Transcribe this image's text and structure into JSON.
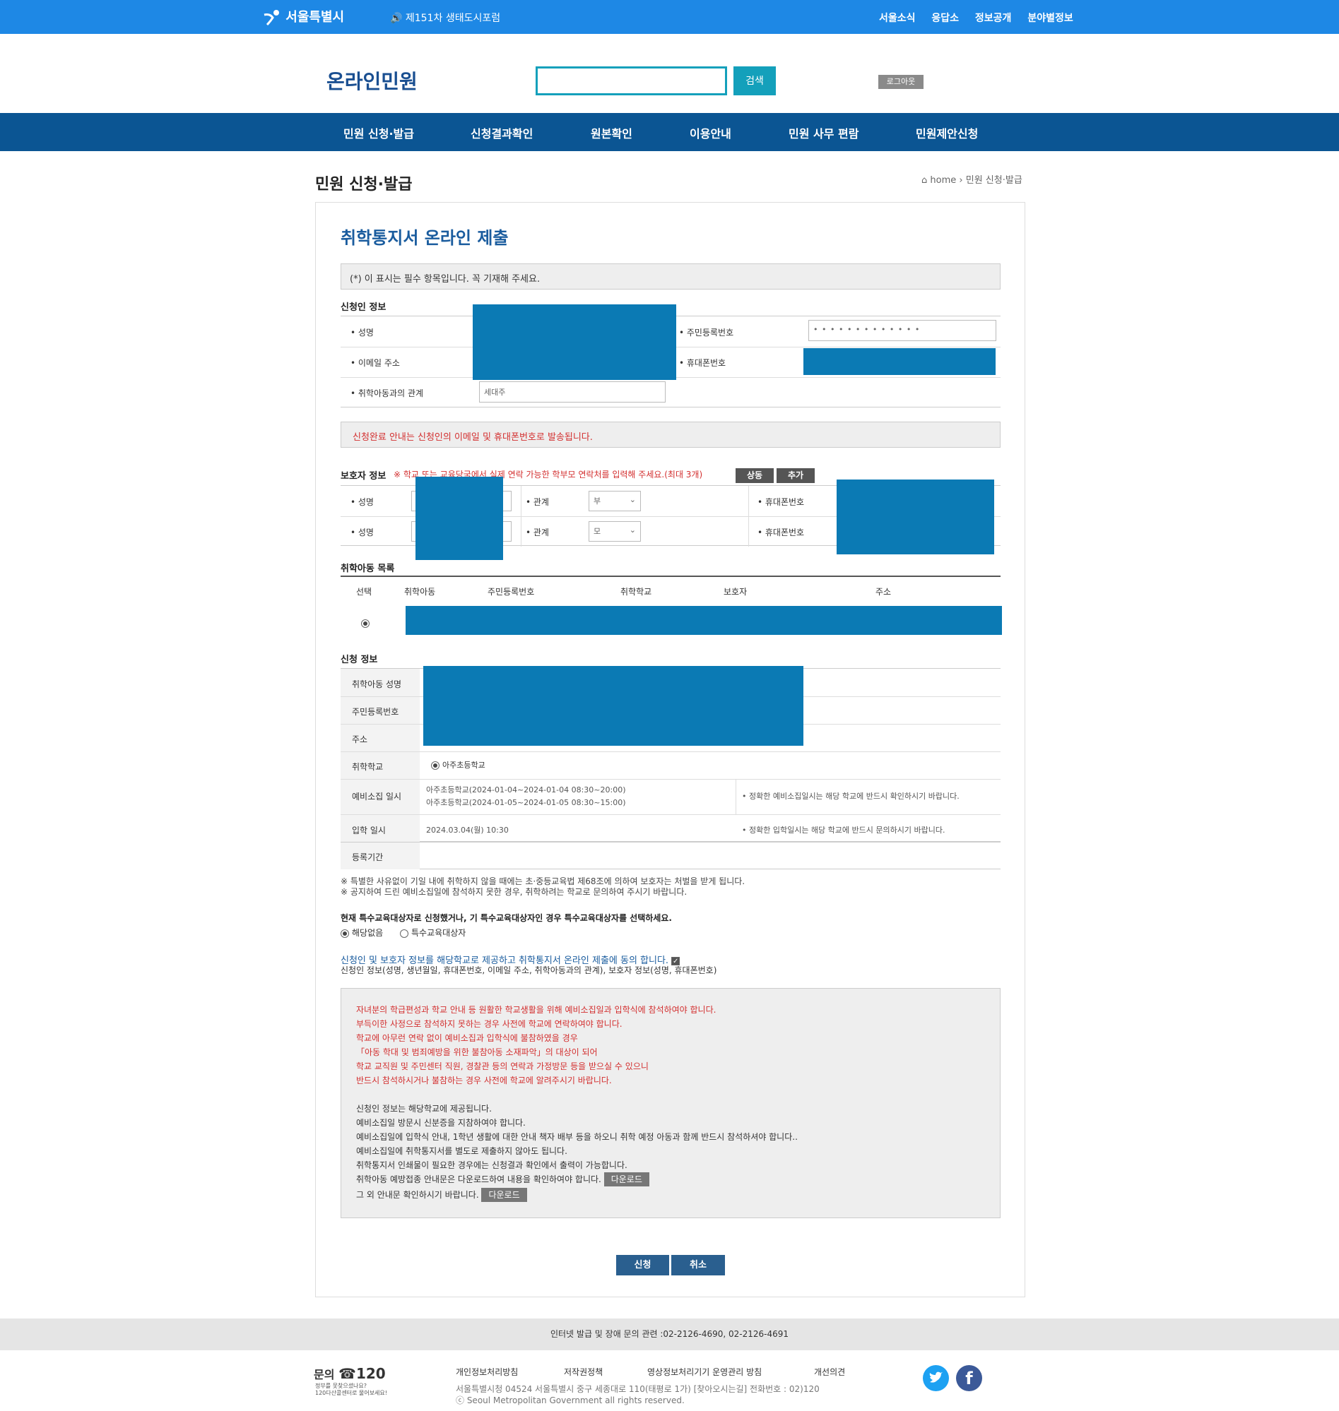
{
  "topbar": {
    "logo": "서울특별시",
    "notice": "🔊 제151차 생태도시포럼",
    "links": [
      "서울소식",
      "응답소",
      "정보공개",
      "분야별정보"
    ]
  },
  "header": {
    "brand": "온라인민원",
    "search_value": "",
    "search_button": "검색",
    "logout": "로그아웃"
  },
  "gnb": [
    "민원 신청·발급",
    "신청결과확인",
    "원본확인",
    "이용안내",
    "민원 사무 편람",
    "민원제안신청"
  ],
  "page": {
    "title": "민원 신청·발급",
    "breadcrumb_home": "home",
    "breadcrumb_current": "민원 신청·발급"
  },
  "form": {
    "heading": "취학통지서 온라인 제출",
    "required_notice": "(*) 이 표시는 필수 항목입니다. 꼭 기재해 주세요.",
    "applicant": {
      "section": "신청인 정보",
      "name_label": "• 성명",
      "rrn_label": "• 주민등록번호",
      "rrn_value": "• • • • • • • • • • • • •",
      "email_label": "• 이메일 주소",
      "phone_label": "• 휴대폰번호",
      "relation_label": "• 취학아동과의 관계",
      "relation_value": "세대주"
    },
    "completion_notice": "신청완료 안내는 신청인의 이메일 및 휴대폰번호로 발송됩니다.",
    "guardian": {
      "section": "보호자 정보",
      "notice": "※ 학교 또는 교육당국에서 실제 연락 가능한 학부모 연락처를 입력해 주세요.(최대 3개)",
      "btn_same": "상동",
      "btn_add": "추가",
      "rows": [
        {
          "name_label": "• 성명",
          "rel_label": "• 관계",
          "rel_value": "부",
          "phone_label": "• 휴대폰번호"
        },
        {
          "name_label": "• 성명",
          "rel_label": "• 관계",
          "rel_value": "모",
          "phone_label": "• 휴대폰번호"
        }
      ]
    },
    "children": {
      "section": "취학아동 목록",
      "headers": [
        "선택",
        "취학아동",
        "주민등록번호",
        "취학학교",
        "보호자",
        "주소"
      ]
    },
    "apply": {
      "section": "신청 정보",
      "rows": [
        "취학아동 성명",
        "주민등록번호",
        "주소",
        "취학학교",
        "예비소집 일시",
        "입학 일시",
        "등록기간"
      ],
      "school": "아주초등학교",
      "prelim_1": "아주초등학교(2024-01-04~2024-01-04 08:30~20:00)",
      "prelim_2": "아주초등학교(2024-01-05~2024-01-05 08:30~15:00)",
      "prelim_note": "• 정확한 예비소집일시는 해당 학교에 반드시 확인하시기 바랍니다.",
      "entrance": "2024.03.04(월) 10:30",
      "entrance_note": "• 정확한 입학일시는 해당 학교에 반드시 문의하시기 바랍니다."
    },
    "warn_1": "※ 특별한 사유없이 기일 내에 취학하지 않을 때에는 초·중등교육법 제68조에 의하여 보호자는 처벌을 받게 됩니다.",
    "warn_2": "※ 공지하여 드린 예비소집일에 참석하지 못한 경우, 취학하려는 학교로 문의하여 주시기 바랍니다.",
    "special_q": "현재 특수교육대상자로 신청했거나, 기 특수교육대상자인 경우 특수교육대상자를 선택하세요.",
    "special_opt1": "해당없음",
    "special_opt2": "특수교육대상자",
    "consent": "신청인 및 보호자 정보를 해당학교로 제공하고 취학통지서 온라인 제출에 동의 합니다.",
    "consent_detail": "신청인 정보(성명, 생년월일, 휴대폰번호, 이메일 주소, 취학아동과의 관계), 보호자 정보(성명, 휴대폰번호)",
    "info_red": [
      "자녀분의 학급편성과 학교 안내 등 원활한 학교생활을 위해 예비소집일과 입학식에 참석하여야 합니다.",
      "부득이한 사정으로 참석하지 못하는 경우 사전에 학교에 연락하여야 합니다.",
      "학교에 아무런 연락 없이 예비소집과 입학식에 불참하였을 경우",
      "「아동 학대 및 범죄예방을 위한 불참아동 소재파악」의 대상이 되어",
      "학교 교직원 및 주민센터 직원, 경찰관 등의 연락과 가정방문 등을 받으실 수 있으니",
      "반드시 참석하시거나 불참하는 경우 사전에 학교에 알려주시기 바랍니다."
    ],
    "info_black": [
      "신청인 정보는 해당학교에 제공됩니다.",
      "예비소집일 방문시 신분증을 지참하여야 합니다.",
      "예비소집일에 입학식 안내, 1학년 생활에 대한 안내 책자 배부 등을 하오니 취학 예정 아동과 함께 반드시 참석하셔야 합니다..",
      "예비소집일에 취학통지서를 별도로 제출하지 않아도 됩니다.",
      "취학통지서 인쇄물이 필요한 경우에는 신청결과 확인에서 출력이 가능합니다.",
      "취학아동 예방접종 안내문은 다운로드하여 내용을 확인하여야 합니다.",
      "그 외 안내문 확인하시기 바랍니다."
    ],
    "download": "다운로드",
    "submit": "신청",
    "cancel": "취소"
  },
  "footer": {
    "contact": "인터넷 발급 및 장애 문의 관련 :02-2126-4690, 02-2126-4691",
    "inquiry": "문의",
    "phone": "☎120",
    "phone_sub1": "정부를 못찾으셨나요?",
    "phone_sub2": "120다산콜센터로 물어보세요!",
    "links": [
      "개인정보처리방침",
      "저작권정책",
      "영상정보처리기기 운영관리 방침",
      "개선의견"
    ],
    "address": "서울특별시청 04524 서울특별시 중구 세종대로 110(태평로 1가) [찾아오시는길] 전화번호 : 02)120",
    "copyright": "ⓒ Seoul Metropolitan Government all rights reserved."
  },
  "colors": {
    "topbar": "#1e88e5",
    "gnb": "#0b5593",
    "accent": "#14a0bb",
    "redaction": "#0b7ab4"
  }
}
